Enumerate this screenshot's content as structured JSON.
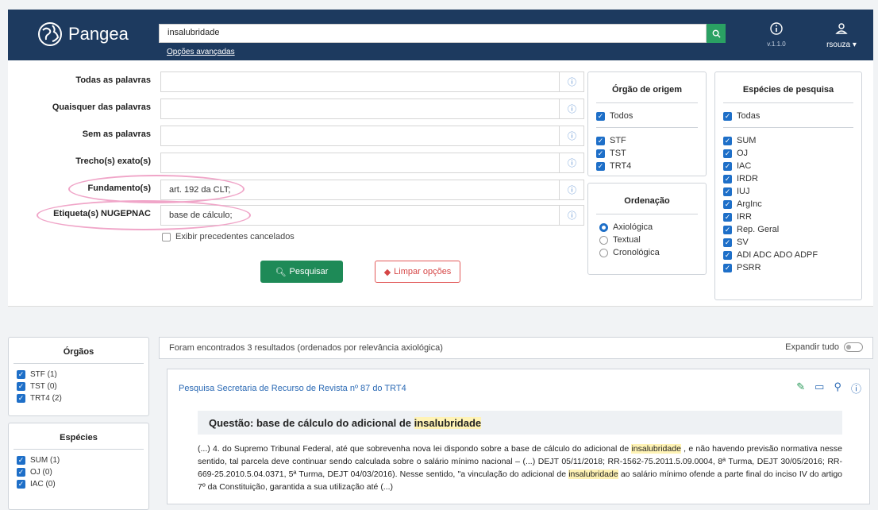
{
  "header": {
    "app_name": "Pangea",
    "search_value": "insalubridade",
    "advanced_link": "Opções avançadas",
    "version": "v.1.1.0",
    "username": "rsouza"
  },
  "form": {
    "rows": [
      {
        "label": "Todas as palavras",
        "value": ""
      },
      {
        "label": "Quaisquer das palavras",
        "value": ""
      },
      {
        "label": "Sem as palavras",
        "value": ""
      },
      {
        "label": "Trecho(s) exato(s)",
        "value": ""
      },
      {
        "label": "Fundamento(s)",
        "value": "art. 192 da CLT;"
      },
      {
        "label": "Etiqueta(s) NUGEPNAC",
        "value": "base de cálculo;"
      }
    ],
    "show_cancelled": "Exibir precedentes cancelados",
    "search_button": "Pesquisar",
    "clear_button": "Limpar opções"
  },
  "origin": {
    "title": "Órgão de origem",
    "all": "Todos",
    "items": [
      "STF",
      "TST",
      "TRT4"
    ]
  },
  "ordering": {
    "title": "Ordenação",
    "options": [
      "Axiológica",
      "Textual",
      "Cronológica"
    ],
    "selected": "Axiológica"
  },
  "species": {
    "title": "Espécies de pesquisa",
    "all": "Todas",
    "items": [
      "SUM",
      "OJ",
      "IAC",
      "IRDR",
      "IUJ",
      "ArgInc",
      "IRR",
      "Rep. Geral",
      "SV",
      "ADI ADC ADO ADPF",
      "PSRR"
    ]
  },
  "sidebar": {
    "organs_title": "Órgãos",
    "organs": [
      "STF (1)",
      "TST (0)",
      "TRT4 (2)"
    ],
    "species_title": "Espécies",
    "species": [
      "SUM (1)",
      "OJ (0)",
      "IAC (0)"
    ]
  },
  "results": {
    "summary": "Foram encontrados 3 resultados (ordenados por relevância axiológica)",
    "expand_all": "Expandir tudo",
    "card": {
      "title": "Pesquisa Secretaria de Recurso de Revista nº 87 do TRT4",
      "question_prefix": "Questão: base de cálculo do adicional de ",
      "question_term": "insalubridade",
      "text_1": "(...) 4. do Supremo Tribunal Federal, até que sobrevenha nova lei dispondo sobre a base de cálculo do adicional de ",
      "text_term_1": "insalubridade",
      "text_2": " , e não havendo previsão normativa nesse sentido, tal parcela deve continuar sendo calculada sobre o salário mínimo nacional – (...) DEJT 05/11/2018; RR-1562-75.2011.5.09.0004, 8ª Turma, DEJT 30/05/2016; RR-669-25.2010.5.04.0371, 5ª Turma, DEJT 04/03/2016). Nesse sentido, \"a vinculação do adicional de ",
      "text_term_2": "insalubridade",
      "text_3": " ao salário mínimo ofende a parte final do inciso IV do artigo 7º da Constituição, garantida a sua utilização até (...)"
    }
  }
}
